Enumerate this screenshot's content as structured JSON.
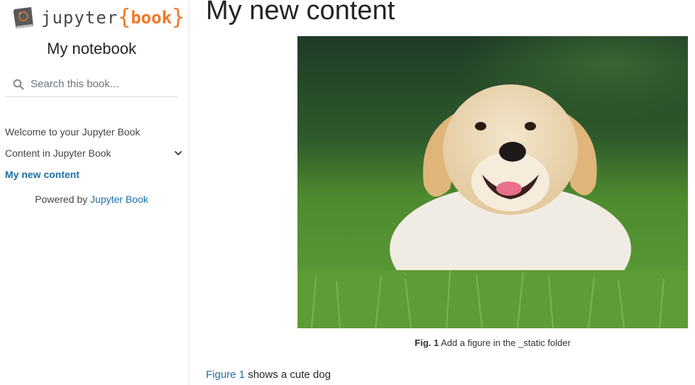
{
  "sidebar": {
    "logo": {
      "word": "jupyter",
      "brace_open": "{",
      "brace_word": "book",
      "brace_close": "}"
    },
    "site_title": "My notebook",
    "search": {
      "placeholder": "Search this book..."
    },
    "nav": [
      {
        "label": "Welcome to your Jupyter Book",
        "active": false
      },
      {
        "label": "Content in Jupyter Book",
        "active": false,
        "expandable": true
      },
      {
        "label": "My new content",
        "active": true
      }
    ],
    "powered_by": {
      "prefix": "Powered by ",
      "link": "Jupyter Book"
    }
  },
  "main": {
    "title": "My new content",
    "figure": {
      "image_subject": "golden retriever puppy lying in grass",
      "caption_label": "Fig. 1",
      "caption_text": " Add a figure in the _static folder"
    },
    "paragraph": {
      "link": "Figure 1",
      "text": " shows a cute dog"
    }
  },
  "colors": {
    "link": "#1a6fa8",
    "brand_orange": "#f37726",
    "text": "#212529",
    "border": "#e6e6e6"
  }
}
